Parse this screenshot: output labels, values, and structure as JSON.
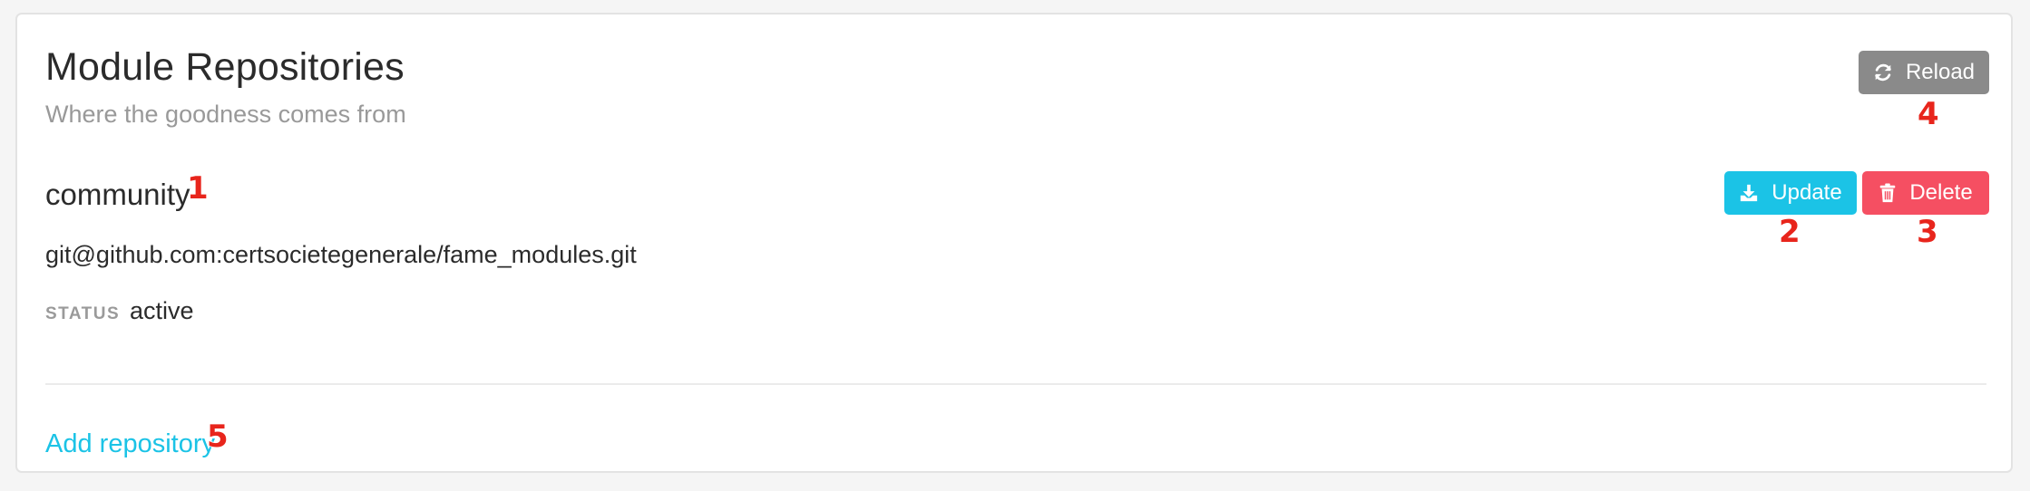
{
  "header": {
    "title": "Module Repositories",
    "subtitle": "Where the goodness comes from",
    "reload_label": "Reload",
    "reload_icon": "refresh-icon"
  },
  "repository": {
    "name": "community",
    "url": "git@github.com:certsocietegenerale/fame_modules.git",
    "status_label": "STATUS",
    "status_value": "active",
    "update_label": "Update",
    "update_icon": "download-icon",
    "delete_label": "Delete",
    "delete_icon": "trash-icon"
  },
  "footer": {
    "add_label": "Add repository"
  },
  "annotations": [
    "1",
    "2",
    "3",
    "4",
    "5"
  ],
  "colors": {
    "accent": "#1bc3e6",
    "danger": "#f54f62",
    "neutral_button": "#8a8a8a",
    "marker": "#e8251c"
  }
}
